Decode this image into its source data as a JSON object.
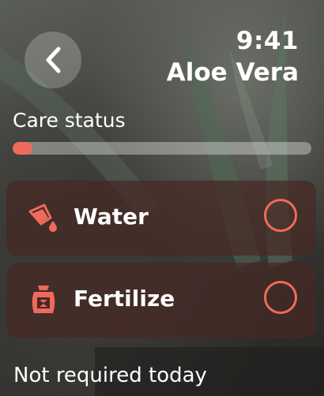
{
  "status_bar": {
    "time": "9:41"
  },
  "header": {
    "title": "Aloe Vera",
    "back_icon": "chevron-left-icon"
  },
  "care": {
    "label": "Care status",
    "progress": 0.065
  },
  "tasks": [
    {
      "label": "Water",
      "icon": "watering-can-icon",
      "completed": false
    },
    {
      "label": "Fertilize",
      "icon": "fertilizer-bag-icon",
      "completed": false
    }
  ],
  "footer": {
    "note": "Not required today"
  },
  "colors": {
    "accent": "#f06a5b",
    "card": "#46282480"
  }
}
